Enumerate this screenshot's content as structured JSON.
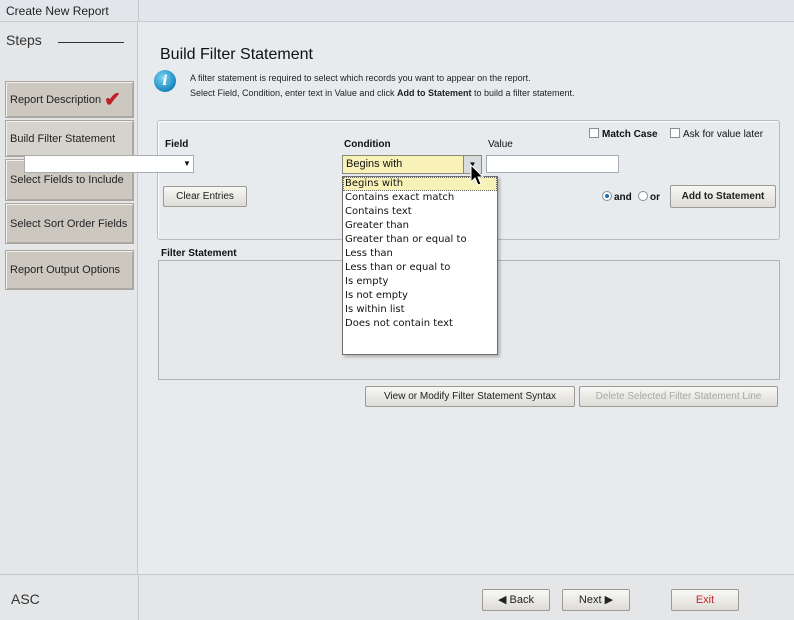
{
  "window": {
    "title": "Create New Report"
  },
  "sidebar": {
    "steps_heading": "Steps",
    "items": [
      {
        "label": "Report Description",
        "completed": true
      },
      {
        "label": "Build Filter Statement",
        "completed": false
      },
      {
        "label": "Select Fields to Include",
        "completed": false
      },
      {
        "label": "Select Sort Order Fields",
        "completed": false
      },
      {
        "label": "Report Output Options",
        "completed": false
      }
    ],
    "footer_label": "ASC"
  },
  "main": {
    "title": "Build Filter Statement",
    "icon": "info-icon",
    "instruction_line1": "A filter statement is required to select which records you want to appear on the report.",
    "instruction_line2_prefix": "Select Field, Condition, enter text in Value and click ",
    "instruction_line2_bold": "Add to Statement",
    "instruction_line2_suffix": " to build a filter statement."
  },
  "builder": {
    "field_label": "Field",
    "field_value": "",
    "condition_label": "Condition",
    "condition_value": "Begins with",
    "value_label": "Value",
    "value_value": "",
    "match_case_label": "Match Case",
    "match_case_checked": false,
    "ask_later_label": "Ask for value later",
    "ask_later_checked": false,
    "clear_button": "Clear Entries",
    "and_label": "and",
    "or_label": "or",
    "logic_selected": "and",
    "add_button": "Add to Statement"
  },
  "condition_options": [
    "Begins with",
    "Contains exact match",
    "Contains text",
    "Greater than",
    "Greater than or equal to",
    "Less than",
    "Less than or equal to",
    "Is empty",
    "Is not empty",
    "Is within list",
    "Does not contain text"
  ],
  "filter": {
    "label": "Filter Statement",
    "view_button": "View or Modify Filter Statement Syntax",
    "delete_button": "Delete Selected Filter Statement Line"
  },
  "footer": {
    "back_button": "Back",
    "next_button": "Next",
    "exit_button": "Exit"
  },
  "colors": {
    "selected_highlight": "#f8f2b8",
    "check_mark": "#c01f2c",
    "exit_text": "#c0262e",
    "info_icon": "#1787bf"
  }
}
